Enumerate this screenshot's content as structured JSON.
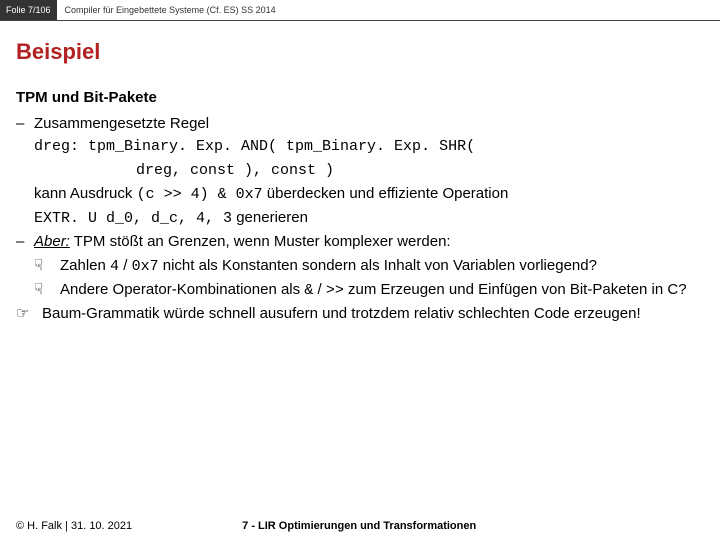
{
  "header": {
    "slide_counter": "Folie 7/106",
    "course": "Compiler für Eingebettete Systeme (Cf. ES) SS 2014"
  },
  "title": "Beispiel",
  "subheading": "TPM und Bit-Pakete",
  "bullet1_label": "Zusammengesetzte Regel",
  "rule_line1": "dreg: tpm_Binary. Exp. AND( tpm_Binary. Exp. SHR(",
  "rule_line2": "dreg, const ), const )",
  "kann_pre": "kann Ausdruck ",
  "kann_code": "(c >> 4) & 0x7",
  "kann_post": " überdecken und effiziente Operation",
  "extr_code": "EXTR. U d_0, d_c, 4, 3",
  "extr_post": " generieren",
  "aber_label": "Aber:",
  "aber_rest": " TPM stößt an Grenzen, wenn Muster komplexer werden:",
  "sub1_pre": "Zahlen ",
  "sub1_c1": "4",
  "sub1_mid1": " / ",
  "sub1_c2": "0x7",
  "sub1_post": " nicht als Konstanten sondern als Inhalt von Variablen vorliegend?",
  "sub2_pre": "Andere Operator-Kombinationen als ",
  "sub2_c1": "&",
  "sub2_mid": " / ",
  "sub2_c2": ">>",
  "sub2_post": " zum Erzeugen und Einfügen von Bit-Paketen in C?",
  "concl": "Baum-Grammatik würde schnell ausufern und trotzdem relativ schlechten Code erzeugen!",
  "footer": {
    "copyright": "© H. Falk | 31. 10. 2021",
    "chapter": "7 - LIR Optimierungen und Transformationen"
  },
  "icons": {
    "dash": "–",
    "hand": "☟",
    "point": "☞"
  }
}
